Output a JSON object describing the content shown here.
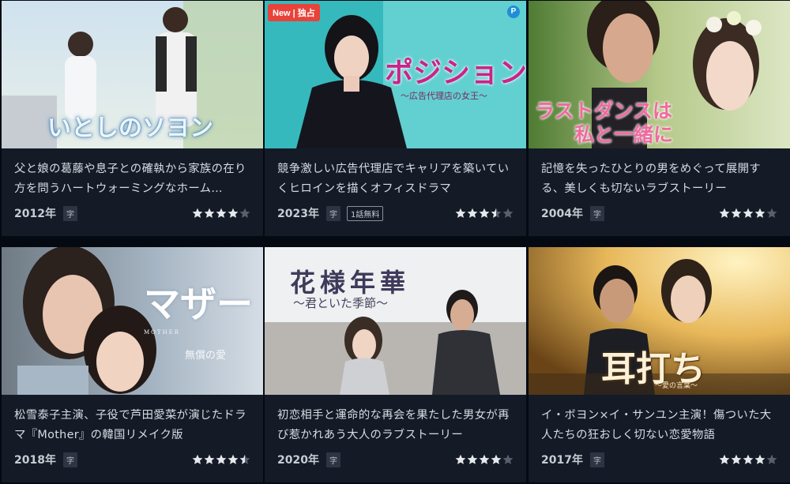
{
  "cards": [
    {
      "thumb_title": "いとしのソヨン",
      "description": "父と娘の葛藤や息子との確執から家族の在り方を問うハートウォーミングなホーム…",
      "year": "2012年",
      "sub_badge": "字",
      "rating_stars": 4,
      "rating_max": 5
    },
    {
      "thumb_title": "ポジション",
      "thumb_subtitle": "〜広告代理店の女王〜",
      "badge_new": "New | 独占",
      "badge_p": "P",
      "description": "競争激しい広告代理店でキャリアを築いていくヒロインを描くオフィスドラマ",
      "year": "2023年",
      "sub_badge": "字",
      "free_badge": "1話無料",
      "rating_stars": 3.5,
      "rating_max": 5
    },
    {
      "thumb_title_line1": "ラストダンスは",
      "thumb_title_line2": "私と一緒に",
      "description": "記憶を失ったひとりの男をめぐって展開する、美しくも切ないラブストーリー",
      "year": "2004年",
      "sub_badge": "字",
      "rating_stars": 4,
      "rating_max": 5
    },
    {
      "thumb_title": "マザー",
      "thumb_subtitle": "無償の愛",
      "thumb_small": "MOTHER",
      "description": "松雪泰子主演、子役で芦田愛菜が演じたドラマ『Mother』の韓国リメイク版",
      "year": "2018年",
      "sub_badge": "字",
      "rating_stars": 4.5,
      "rating_max": 5
    },
    {
      "thumb_title": "花様年華",
      "thumb_subtitle": "〜君といた季節〜",
      "description": "初恋相手と運命的な再会を果たした男女が再び惹かれあう大人のラブストーリー",
      "year": "2020年",
      "sub_badge": "字",
      "rating_stars": 4,
      "rating_max": 5
    },
    {
      "thumb_title": "耳打ち",
      "thumb_subtitle": "〜愛の言葉〜",
      "description": "イ・ボヨン×イ・サンユン主演！傷ついた大人たちの狂おしく切ない恋愛物語",
      "year": "2017年",
      "sub_badge": "字",
      "rating_stars": 4,
      "rating_max": 5
    }
  ],
  "colors": {
    "background": "#050a12",
    "card": "#141b27",
    "star_on": "#e6e8ec",
    "star_off": "#5a606b",
    "new_badge": "#e8433b"
  }
}
